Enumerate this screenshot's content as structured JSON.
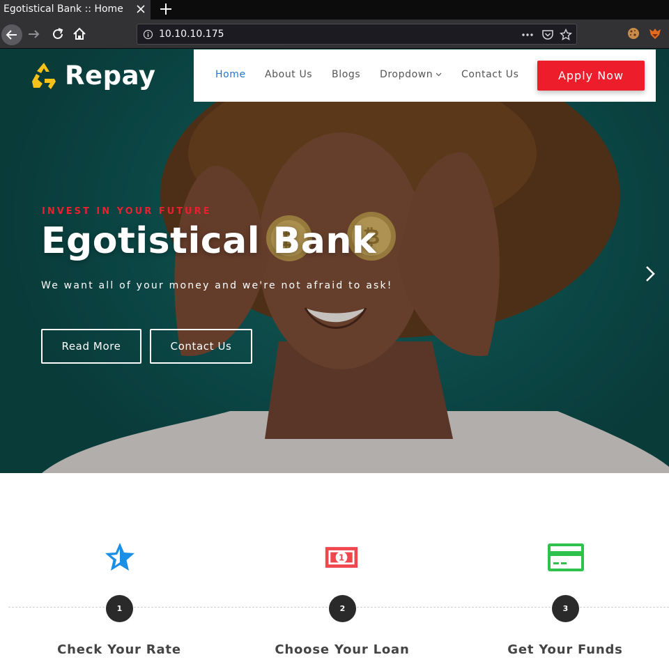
{
  "browser": {
    "tab_title": "Egotistical Bank :: Home",
    "url": "10.10.10.175"
  },
  "site": {
    "logo_text": "Repay",
    "nav": [
      {
        "label": "Home",
        "active": true
      },
      {
        "label": "About Us",
        "active": false
      },
      {
        "label": "Blogs",
        "active": false
      },
      {
        "label": "Dropdown",
        "active": false
      },
      {
        "label": "Contact Us",
        "active": false
      }
    ],
    "apply_label": "Apply Now",
    "colors": {
      "accent": "#ee1d2c",
      "nav_active": "#1e75d0",
      "hero_bg": "#0f5957"
    }
  },
  "hero": {
    "eyebrow": "INVEST IN YOUR FUTURE",
    "title": "Egotistical Bank",
    "subtitle": "We want all of your money and we're not afraid to ask!",
    "buttons": [
      "Read More",
      "Contact Us"
    ]
  },
  "steps": [
    {
      "number": "1",
      "label": "Check Your Rate",
      "icon": "star-icon"
    },
    {
      "number": "2",
      "label": "Choose Your Loan",
      "icon": "money-icon"
    },
    {
      "number": "3",
      "label": "Get Your Funds",
      "icon": "credit-card-icon"
    }
  ]
}
